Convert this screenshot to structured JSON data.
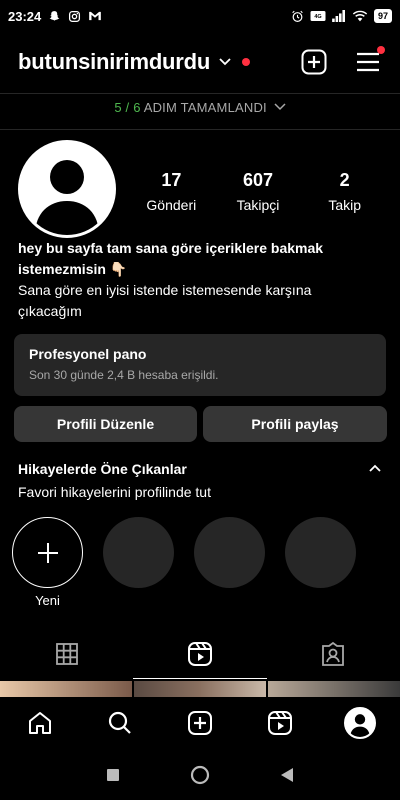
{
  "status_bar": {
    "time": "23:24",
    "battery": "97"
  },
  "header": {
    "username": "butunsinirimdurdu"
  },
  "steps": {
    "done": "5",
    "separator": " / ",
    "total": "6",
    "label": " ADIM TAMAMLANDI"
  },
  "stats": [
    {
      "value": "17",
      "label": "Gönderi"
    },
    {
      "value": "607",
      "label": "Takipçi"
    },
    {
      "value": "2",
      "label": "Takip"
    }
  ],
  "bio": {
    "line1": "hey bu sayfa tam sana göre içeriklere bakmak istemezmisin 👇🏻",
    "line2": "Sana göre en iyisi istende istemesende karşına çıkacağım"
  },
  "pro_dashboard": {
    "title": "Profesyonel pano",
    "subtitle": "Son 30 günde 2,4 B hesaba erişildi."
  },
  "buttons": {
    "edit_profile": "Profili Düzenle",
    "share_profile": "Profili paylaş"
  },
  "highlights": {
    "title": "Hikayelerde Öne Çıkanlar",
    "subtitle": "Favori hikayelerini profilinde tut",
    "new_label": "Yeni"
  },
  "colors": {
    "accent_red": "#ff3040",
    "steps_green": "#4fb84f",
    "card_bg": "#262626",
    "button_bg": "#363636"
  },
  "icons": {
    "header": [
      "chevron-down-icon",
      "plus-square-icon",
      "menu-icon"
    ],
    "tabs": [
      "grid-icon",
      "reels-icon",
      "tagged-icon"
    ],
    "bottom_nav": [
      "home-icon",
      "search-icon",
      "create-icon",
      "reels-icon",
      "profile-avatar"
    ],
    "system_nav": [
      "recents-icon",
      "home-circle-icon",
      "back-icon"
    ]
  }
}
